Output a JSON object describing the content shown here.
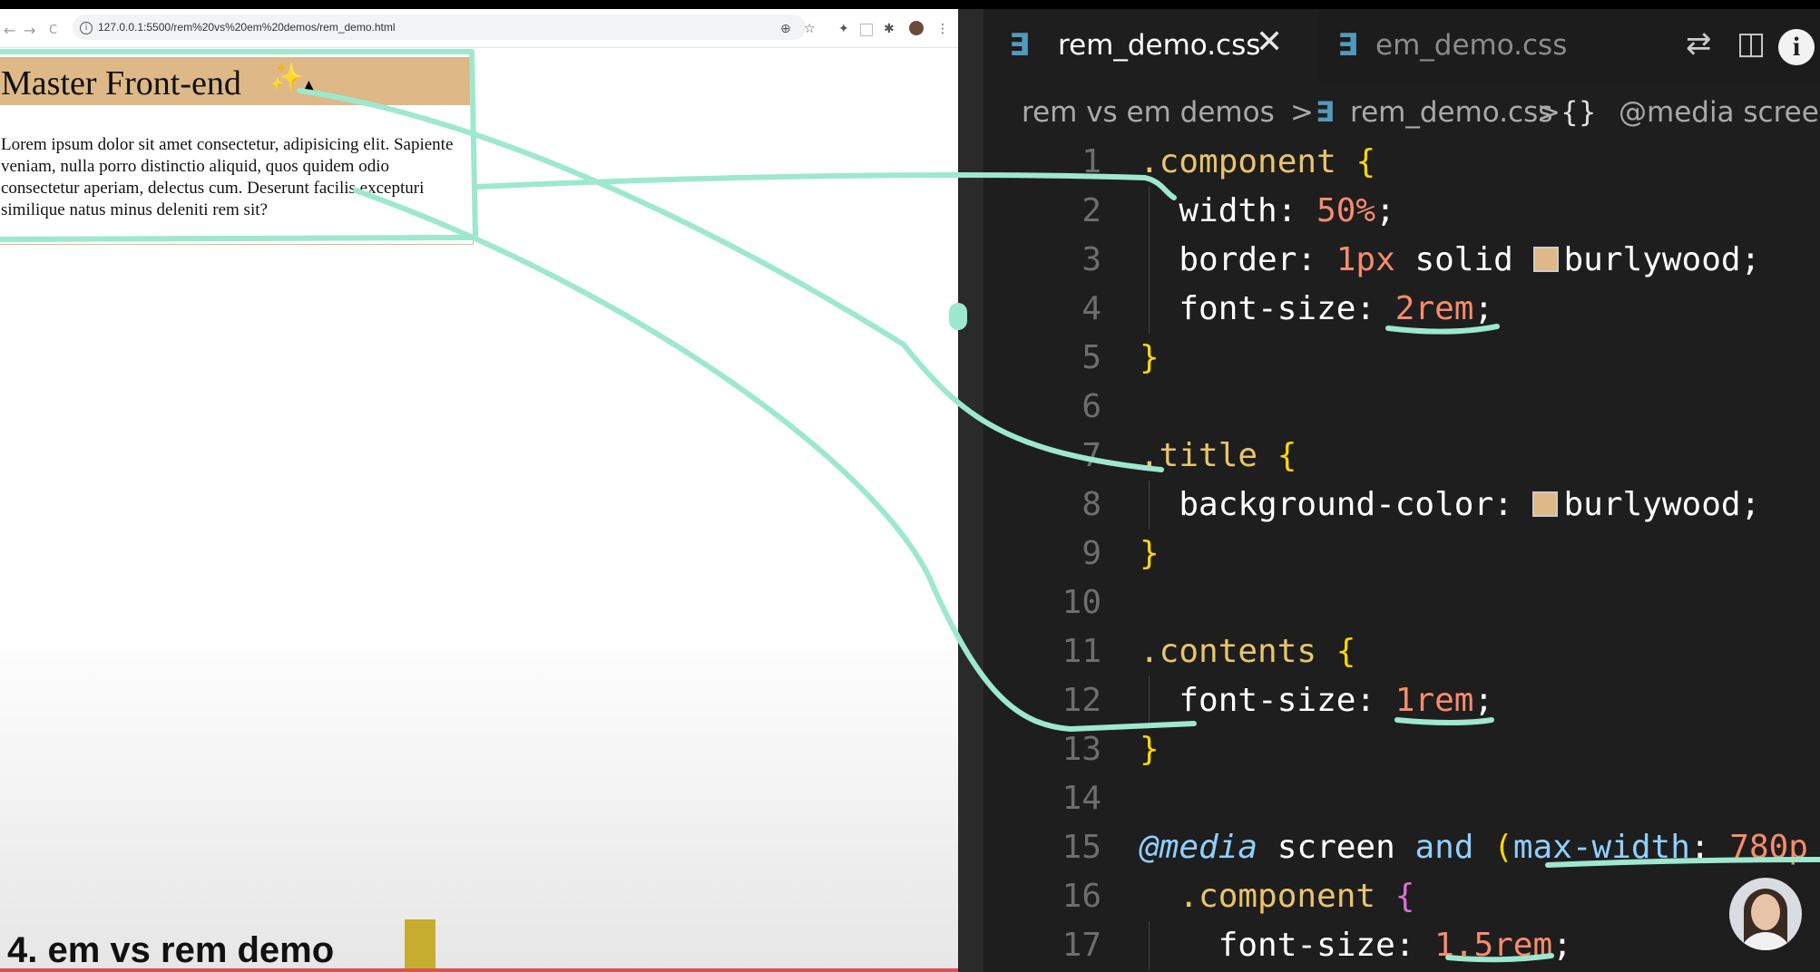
{
  "browser": {
    "nav": {
      "back": "←",
      "forward": "→",
      "reload": "C"
    },
    "url": "127.0.0.1:5500/rem%20vs%20em%20demos/rem_demo.html",
    "url_info": "i",
    "toolbar_icons": {
      "zoom": "⊕",
      "star": "☆",
      "extension": "✦",
      "puzzle": "✱",
      "menu": "⋮"
    }
  },
  "page": {
    "title": "Master Front-end",
    "sparkles": "✨",
    "contents": "Lorem ipsum dolor sit amet consectetur, adipisicing elit. Sapiente veniam, nulla porro distinctio aliquid, quos quidem odio consectetur aperiam, delectus cum. Deserunt facilis excepturi similique natus minus deleniti rem sit?"
  },
  "slide": {
    "caption": "4. em vs rem demo"
  },
  "editor": {
    "tabs": [
      {
        "icon": "∃",
        "label": "rem_demo.css",
        "active": true
      },
      {
        "icon": "∃",
        "label": "em_demo.css",
        "active": false
      }
    ],
    "tab_close": "✕",
    "actions": {
      "compare": "⇄",
      "split": "◫",
      "info": "i",
      "more": "⋯"
    },
    "breadcrumb": {
      "folder": "rem vs em demos",
      "sep1": ">",
      "file_icon": "∃",
      "file": "rem_demo.css",
      "sep2": ">",
      "symbol_icon": "{}",
      "symbol": "@media screen"
    },
    "code_lines": [
      {
        "n": "1",
        "parts": [
          [
            "sel",
            ".component"
          ],
          [
            "txt",
            " "
          ],
          [
            "brace",
            "{"
          ]
        ]
      },
      {
        "n": "2",
        "parts": [
          [
            "txt",
            "  width: "
          ],
          [
            "val",
            "50%"
          ],
          [
            "txt",
            ";"
          ]
        ]
      },
      {
        "n": "3",
        "parts": [
          [
            "txt",
            "  border: "
          ],
          [
            "val",
            "1px"
          ],
          [
            "txt",
            " solid "
          ],
          [
            "swatch",
            ""
          ],
          [
            "txt",
            "burlywood;"
          ]
        ]
      },
      {
        "n": "4",
        "parts": [
          [
            "txt",
            "  font-size: "
          ],
          [
            "val",
            "2rem"
          ],
          [
            "txt",
            ";"
          ]
        ]
      },
      {
        "n": "5",
        "parts": [
          [
            "brace",
            "}"
          ]
        ]
      },
      {
        "n": "6",
        "parts": []
      },
      {
        "n": "7",
        "parts": [
          [
            "sel",
            ".title"
          ],
          [
            "txt",
            " "
          ],
          [
            "brace",
            "{"
          ]
        ]
      },
      {
        "n": "8",
        "parts": [
          [
            "txt",
            "  background-color: "
          ],
          [
            "swatch",
            ""
          ],
          [
            "txt",
            "burlywood;"
          ]
        ]
      },
      {
        "n": "9",
        "parts": [
          [
            "brace",
            "}"
          ]
        ]
      },
      {
        "n": "10",
        "parts": []
      },
      {
        "n": "11",
        "parts": [
          [
            "sel",
            ".contents"
          ],
          [
            "txt",
            " "
          ],
          [
            "brace",
            "{"
          ]
        ]
      },
      {
        "n": "12",
        "parts": [
          [
            "txt",
            "  font-size: "
          ],
          [
            "val",
            "1rem"
          ],
          [
            "txt",
            ";"
          ]
        ]
      },
      {
        "n": "13",
        "parts": [
          [
            "brace",
            "}"
          ]
        ]
      },
      {
        "n": "14",
        "parts": []
      },
      {
        "n": "15",
        "parts": [
          [
            "media",
            "@media"
          ],
          [
            "txt",
            " screen "
          ],
          [
            "ident",
            "and"
          ],
          [
            "txt",
            " "
          ],
          [
            "brace",
            "("
          ],
          [
            "ident",
            "max-width"
          ],
          [
            "txt",
            ": "
          ],
          [
            "val",
            "780p"
          ]
        ]
      },
      {
        "n": "16",
        "parts": [
          [
            "sel",
            "  .component"
          ],
          [
            "txt",
            " "
          ],
          [
            "pbrace",
            "{"
          ]
        ]
      },
      {
        "n": "17",
        "parts": [
          [
            "txt",
            "    font-size: "
          ],
          [
            "val",
            "1.5rem"
          ],
          [
            "txt",
            ";"
          ]
        ]
      }
    ]
  },
  "colors": {
    "burlywood": "#deb887",
    "annotation": "#9de8cf",
    "editor_bg": "#1e1e1e"
  }
}
